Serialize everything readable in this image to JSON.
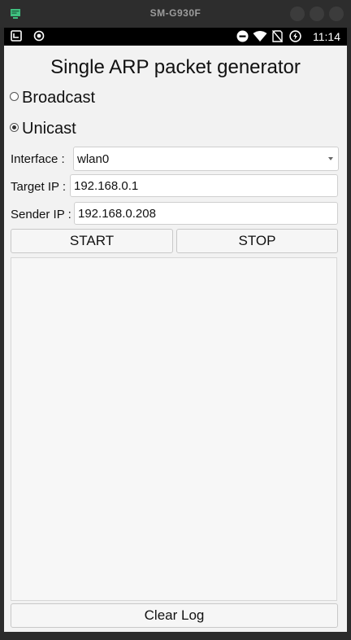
{
  "window": {
    "title": "SM-G930F"
  },
  "status_bar": {
    "time": "11:14",
    "icons": [
      "screenshot-icon",
      "record-icon",
      "do-not-disturb-icon",
      "wifi-icon",
      "no-sim-icon",
      "battery-charging-icon"
    ]
  },
  "app": {
    "title": "Single ARP packet generator",
    "mode_options": [
      {
        "label": "Broadcast",
        "checked": false
      },
      {
        "label": "Unicast",
        "checked": true
      }
    ],
    "interface": {
      "label": "Interface :",
      "value": "wlan0"
    },
    "target_ip": {
      "label": "Target IP :",
      "value": "192.168.0.1"
    },
    "sender_ip": {
      "label": "Sender IP :",
      "value": "192.168.0.208"
    },
    "buttons": {
      "start": "START",
      "stop": "STOP",
      "clear_log": "Clear Log"
    },
    "log": ""
  }
}
